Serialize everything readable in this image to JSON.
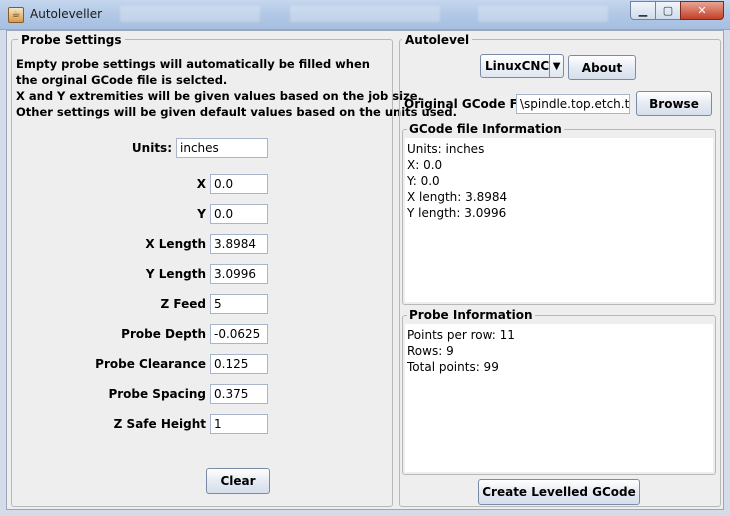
{
  "window": {
    "title": "Autoleveller"
  },
  "probe_settings": {
    "title": "Probe Settings",
    "info_lines": [
      "Empty probe settings will automatically be filled when",
      "the orginal GCode file is selcted.",
      "X and Y extremities will be given values based on the job size.",
      "Other settings will be given default values based on the units used."
    ],
    "units": {
      "label": "Units:",
      "value": "inches"
    },
    "x": {
      "label": "X",
      "value": "0.0"
    },
    "y": {
      "label": "Y",
      "value": "0.0"
    },
    "x_length": {
      "label": "X Length",
      "value": "3.8984"
    },
    "y_length": {
      "label": "Y Length",
      "value": "3.0996"
    },
    "z_feed": {
      "label": "Z Feed",
      "value": "5"
    },
    "probe_depth": {
      "label": "Probe Depth",
      "value": "-0.0625"
    },
    "probe_clearance": {
      "label": "Probe Clearance",
      "value": "0.125"
    },
    "probe_spacing": {
      "label": "Probe Spacing",
      "value": "0.375"
    },
    "z_safe_height": {
      "label": "Z Safe Height",
      "value": "1"
    },
    "clear_label": "Clear"
  },
  "autolevel": {
    "title": "Autolevel",
    "controller_selected": "LinuxCNC",
    "about_label": "About",
    "original_gcode_label": "Original GCode File",
    "original_gcode_value": "\\spindle.top.etch.tap",
    "browse_label": "Browse",
    "gcode_info": {
      "title": "GCode file Information",
      "lines": [
        "Units: inches",
        "X: 0.0",
        "Y: 0.0",
        "X length: 3.8984",
        "Y length: 3.0996"
      ]
    },
    "probe_info": {
      "title": "Probe Information",
      "lines": [
        "Points per row: 11",
        "Rows: 9",
        "Total points: 99"
      ]
    },
    "create_label": "Create Levelled GCode"
  }
}
